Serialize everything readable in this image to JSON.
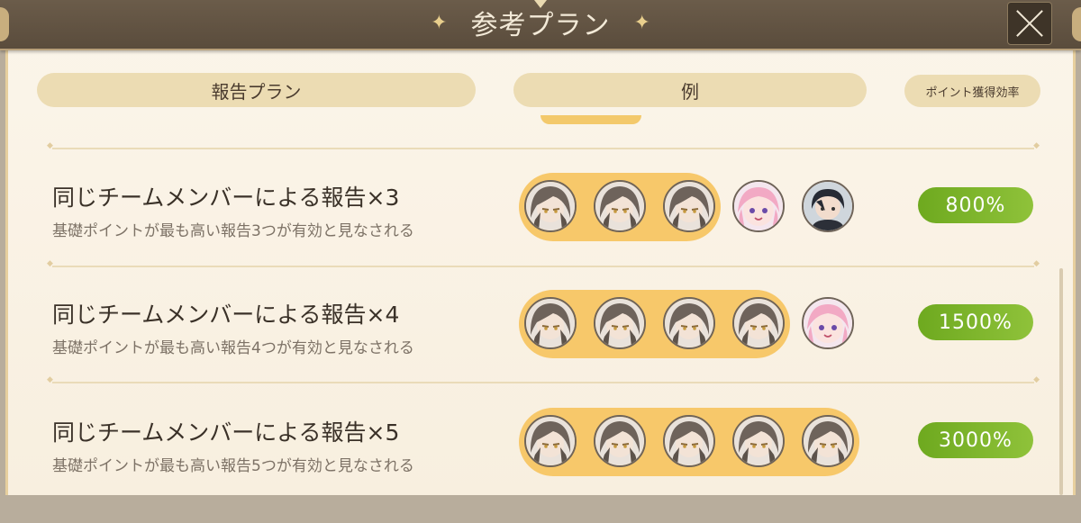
{
  "title": "参考プラン",
  "close_icon": "close-icon",
  "headers": {
    "plan": "報告プラン",
    "example": "例",
    "efficiency": "ポイント獲得効率"
  },
  "rows": [
    {
      "title": "同じチームメンバーによる報告×3",
      "subtitle": "基礎ポイントが最も高い報告3つが有効と見なされる",
      "same_member_count": 3,
      "avatars": [
        "gray-hair-character",
        "gray-hair-character",
        "gray-hair-character",
        "pink-hair-character",
        "dark-hair-character"
      ],
      "efficiency": "800%"
    },
    {
      "title": "同じチームメンバーによる報告×4",
      "subtitle": "基礎ポイントが最も高い報告4つが有効と見なされる",
      "same_member_count": 4,
      "avatars": [
        "gray-hair-character",
        "gray-hair-character",
        "gray-hair-character",
        "gray-hair-character",
        "pink-hair-character"
      ],
      "efficiency": "1500%"
    },
    {
      "title": "同じチームメンバーによる報告×5",
      "subtitle": "基礎ポイントが最も高い報告5つが有効と見なされる",
      "same_member_count": 5,
      "avatars": [
        "gray-hair-character",
        "gray-hair-character",
        "gray-hair-character",
        "gray-hair-character",
        "gray-hair-character"
      ],
      "efficiency": "3000%"
    }
  ],
  "colors": {
    "highlight_pill": "#f7c86a",
    "efficiency_green": "#7ab52a",
    "header_pill": "#ecdcb3"
  }
}
